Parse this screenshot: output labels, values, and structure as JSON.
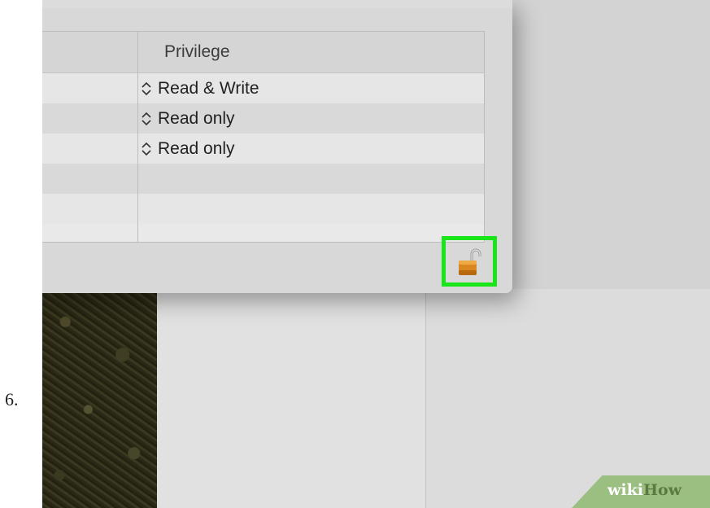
{
  "step_number": "6.",
  "permissions_table": {
    "column_header": "Privilege",
    "rows": [
      {
        "privilege": "Read & Write"
      },
      {
        "privilege": "Read only"
      },
      {
        "privilege": "Read only"
      },
      {
        "privilege": ""
      },
      {
        "privilege": ""
      }
    ]
  },
  "lock": {
    "icon": "unlocked-padlock-icon",
    "highlight_color": "#18e619"
  },
  "watermark": {
    "part1": "wiki",
    "part2": "How"
  }
}
